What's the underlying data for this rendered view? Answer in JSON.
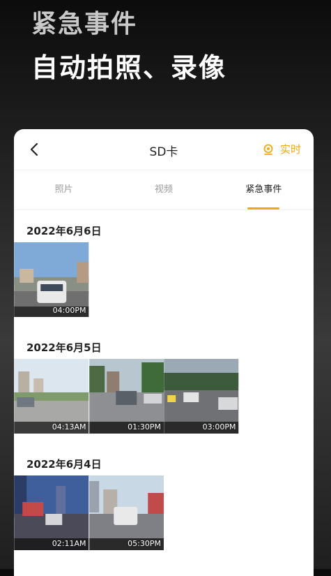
{
  "promo": {
    "line1": "紧急事件",
    "line2": "自动拍照、录像"
  },
  "navbar": {
    "title": "SD卡",
    "live_label": "实时"
  },
  "tabs": [
    {
      "label": "照片",
      "active": false
    },
    {
      "label": "视频",
      "active": false
    },
    {
      "label": "紧急事件",
      "active": true
    }
  ],
  "groups": [
    {
      "date": "2022年6月6日",
      "items": [
        {
          "time": "04:00PM"
        }
      ]
    },
    {
      "date": "2022年6月5日",
      "items": [
        {
          "time": "04:13AM"
        },
        {
          "time": "01:30PM"
        },
        {
          "time": "03:00PM"
        }
      ]
    },
    {
      "date": "2022年6月4日",
      "items": [
        {
          "time": "02:11AM"
        },
        {
          "time": "05:30PM"
        }
      ]
    }
  ],
  "colors": {
    "accent": "#f3a712"
  }
}
